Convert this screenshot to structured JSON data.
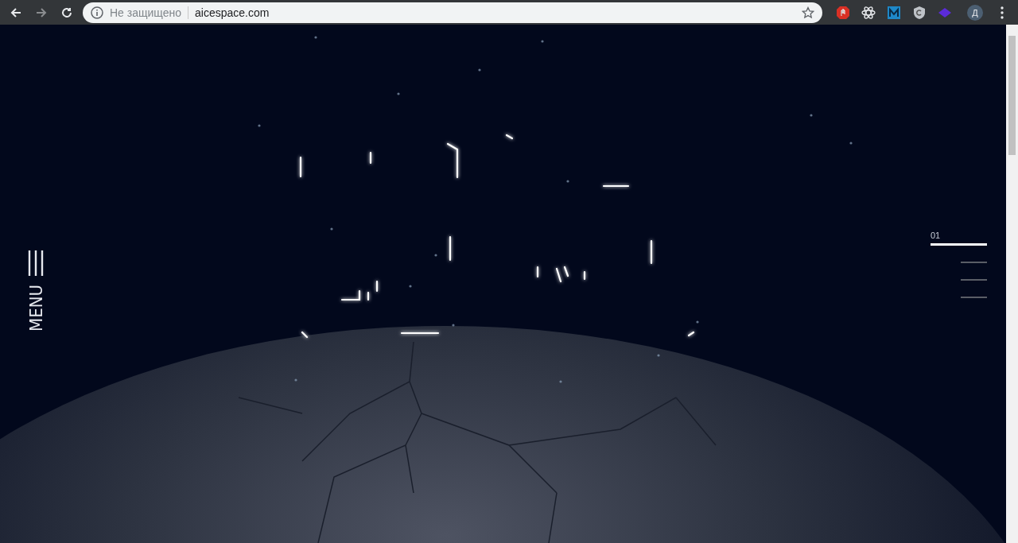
{
  "browser": {
    "security_label": "Не защищено",
    "url": "aicespace.com",
    "profile_initial": "Д"
  },
  "menu": {
    "label": "MENU"
  },
  "slides": [
    {
      "label": "01",
      "selected": true
    },
    {
      "selected": false
    },
    {
      "selected": false
    },
    {
      "selected": false
    }
  ]
}
